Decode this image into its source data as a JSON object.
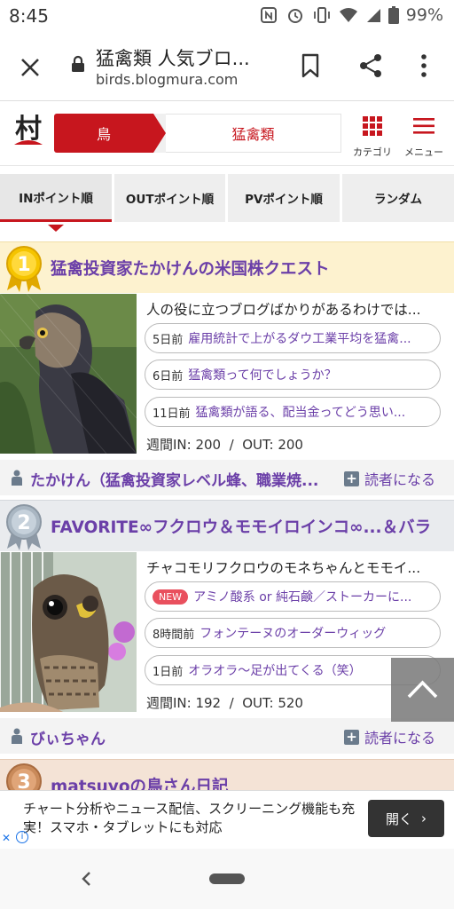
{
  "status": {
    "time": "8:45",
    "battery": "99%"
  },
  "browser": {
    "title": "猛禽類 人気ブロ...",
    "url": "birds.blogmura.com"
  },
  "site": {
    "logo_text": "村",
    "crumb_bird": "鳥",
    "crumb_raptor": "猛禽類",
    "category_label": "カテゴリ",
    "menu_label": "メニュー"
  },
  "tabs": [
    {
      "label": "INポイント順"
    },
    {
      "label": "OUTポイント順"
    },
    {
      "label": "PVポイント順"
    },
    {
      "label": "ランダム"
    }
  ],
  "entries": [
    {
      "rank": "1",
      "title": "猛禽投資家たかけんの米国株クエスト",
      "description": "人の役に立つブログばかりがあるわけでは...",
      "posts": [
        {
          "when": "5日前",
          "text": "雇用統計で上がるダウ工業平均を猛禽..."
        },
        {
          "when": "6日前",
          "text": "猛禽類って何でしょうか？"
        },
        {
          "when": "11日前",
          "text": "猛禽類が語る、配当金ってどう思い..."
        }
      ],
      "weekly": "週間IN: 200  /  OUT: 200",
      "author": "たかけん（猛禽投資家レベル蜂、職業焼...",
      "follow": "読者になる"
    },
    {
      "rank": "2",
      "title": "FAVORITE∞フクロウ＆モモイロインコ∞...＆バラ",
      "description": "チャコモリフクロウのモネちゃんとモモイ...",
      "posts": [
        {
          "when": "NEW",
          "text": "アミノ酸系 or 純石鹸／ストーカーに..."
        },
        {
          "when": "8時間前",
          "text": "フォンテーヌのオーダーウィッグ"
        },
        {
          "when": "1日前",
          "text": "オラオラ〜足が出てくる（笑）"
        }
      ],
      "weekly": "週間IN: 192  /  OUT: 520",
      "author": "びぃちゃん",
      "follow": "読者になる"
    },
    {
      "rank": "3",
      "title": "matsuyoの鳥さん日記"
    }
  ],
  "ad": {
    "text": "チャート分析やニュース配信、スクリーニング機能も充実！スマホ・タブレットにも対応",
    "button": "開く"
  }
}
